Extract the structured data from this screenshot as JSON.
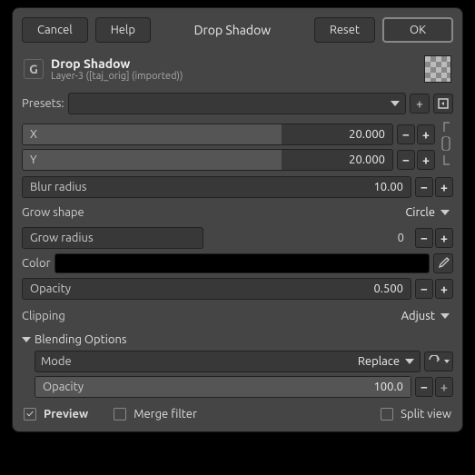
{
  "titlebar": {
    "cancel": "Cancel",
    "help": "Help",
    "title": "Drop Shadow",
    "reset": "Reset",
    "ok": "OK"
  },
  "header": {
    "title": "Drop Shadow",
    "subtitle": "Layer-3 ([taj_orig] (imported))"
  },
  "presets_label": "Presets:",
  "params": {
    "x": {
      "label": "X",
      "value": "20.000"
    },
    "y": {
      "label": "Y",
      "value": "20.000"
    },
    "blur": {
      "label": "Blur radius",
      "value": "10.00"
    },
    "grow_shape": {
      "label": "Grow shape",
      "value": "Circle"
    },
    "grow_radius": {
      "label": "Grow radius",
      "value": "0"
    },
    "color": {
      "label": "Color",
      "value": "#000000"
    },
    "opacity": {
      "label": "Opacity",
      "value": "0.500"
    },
    "clipping": {
      "label": "Clipping",
      "value": "Adjust"
    }
  },
  "blending": {
    "title": "Blending Options",
    "mode": {
      "label": "Mode",
      "value": "Replace"
    },
    "opacity": {
      "label": "Opacity",
      "value": "100.0"
    }
  },
  "footer": {
    "preview": "Preview",
    "merge": "Merge filter",
    "split": "Split view"
  }
}
